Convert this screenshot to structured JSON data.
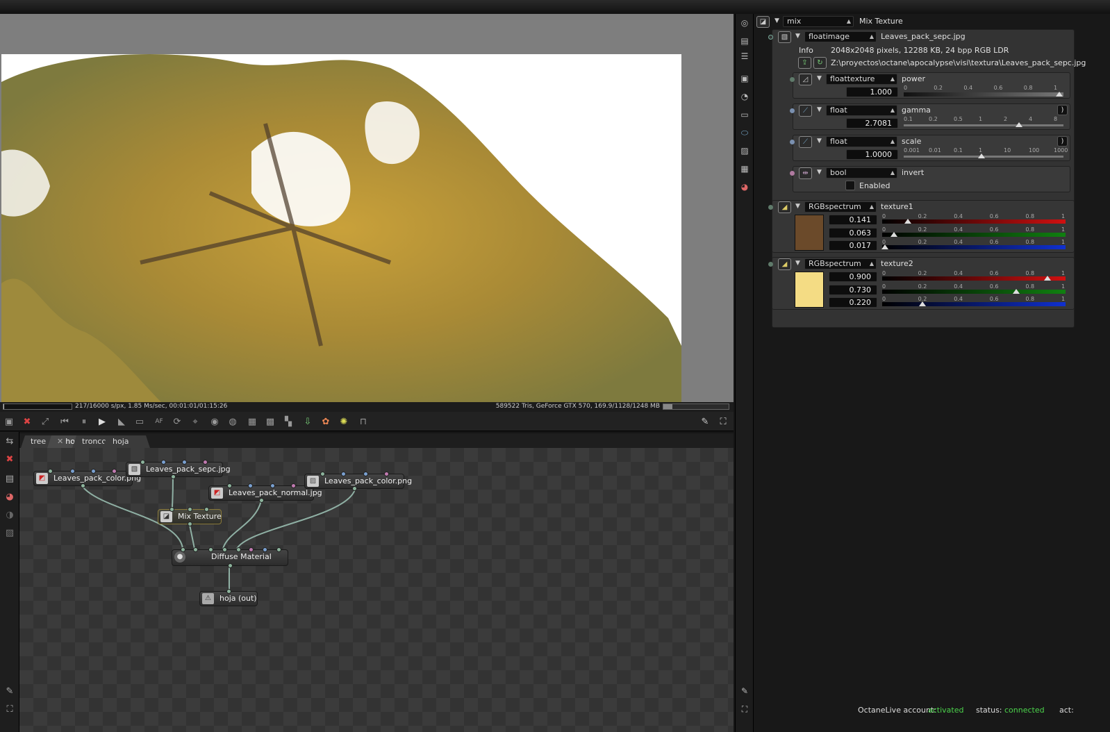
{
  "viewport": {
    "status_left": "217/16000 s/px, 1.85 Ms/sec, 00:01:01/01:15:26",
    "status_right": "589522 Tris, GeForce GTX 570, 169.9/1128/1248 MB",
    "render_progress": 0.0136,
    "memory_fraction": 0.14
  },
  "viewport_toolbar": {
    "icons": [
      "camera-icon",
      "clear-icon",
      "fit-icon",
      "rewind-icon",
      "pause-icon",
      "play-icon",
      "focus-icon",
      "film-icon",
      "af-icon",
      "rotate-icon",
      "pick-icon",
      "region-icon",
      "render-region-icon",
      "checker-icon",
      "alpha-icon",
      "quad-icon",
      "import-icon",
      "color-icon",
      "bulb-icon",
      "lock-icon"
    ],
    "af_label": "AF",
    "right_icons": [
      "wrench-icon",
      "fullscreen-icon"
    ]
  },
  "graph_tabs": [
    {
      "label": "tree",
      "active": false
    },
    {
      "label": "hoja",
      "active": true,
      "closable": true
    },
    {
      "label": "tronco",
      "active": false
    },
    {
      "label": "hoja SSS",
      "active": false
    }
  ],
  "nodes": {
    "color1": "Leaves_pack_color.png",
    "sepc": "Leaves_pack_sepc.jpg",
    "normal": "Leaves_pack_normal.jpg",
    "color2": "Leaves_pack_color.png",
    "mix": "Mix Texture",
    "diffuse": "Diffuse Material",
    "out": "hoja (out)"
  },
  "inspector": {
    "root_type": "mix",
    "root_name": "Mix Texture",
    "image": {
      "type": "floatimage",
      "name": "Leaves_pack_sepc.jpg",
      "info_label": "Info",
      "info": "2048x2048 pixels, 12288 KB, 24 bpp RGB LDR",
      "path": "Z:\\proyectos\\octane\\apocalypse\\visi\\textura\\Leaves_pack_sepc.jpg"
    },
    "power": {
      "type": "floattexture",
      "name": "power",
      "value": "1.000",
      "ticks": [
        "0",
        "0.2",
        "0.4",
        "0.6",
        "0.8",
        "1"
      ],
      "fraction": 1.0
    },
    "gamma": {
      "type": "float",
      "name": "gamma",
      "value": "2.7081",
      "ticks": [
        "0.1",
        "0.2",
        "0.5",
        "1",
        "2",
        "4",
        "8"
      ],
      "fraction": 0.74
    },
    "scale": {
      "type": "float",
      "name": "scale",
      "value": "1.0000",
      "ticks": [
        "0.001",
        "0.01",
        "0.1",
        "1",
        "10",
        "100",
        "1000"
      ],
      "fraction": 0.5
    },
    "invert": {
      "type": "bool",
      "name": "invert",
      "checkbox_label": "Enabled",
      "checked": false
    },
    "texture1": {
      "type": "RGBspectrum",
      "name": "texture1",
      "r": "0.141",
      "g": "0.063",
      "b": "0.017",
      "swatch": "#6b4a2a"
    },
    "texture2": {
      "type": "RGBspectrum",
      "name": "texture2",
      "r": "0.900",
      "g": "0.730",
      "b": "0.220",
      "swatch": "#f4dc84"
    },
    "channel_ticks": [
      "0",
      "0.2",
      "0.4",
      "0.6",
      "0.8",
      "1"
    ]
  },
  "footer": {
    "account_label": "OctaneLive account:",
    "account_value": "activated",
    "status_label": "status:",
    "status_value": "connected",
    "act_label": "act:"
  },
  "colors": {
    "accent_green": "#4cd44c",
    "red_channel": "#d01010",
    "green_channel": "#108010",
    "blue_channel": "#1030d0"
  }
}
